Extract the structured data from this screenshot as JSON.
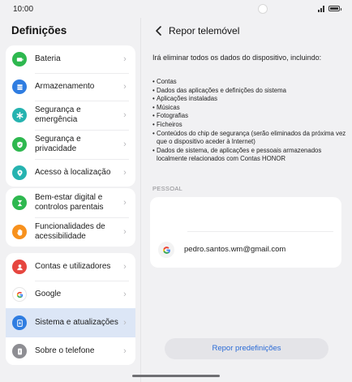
{
  "status_bar": {
    "time": "10:00"
  },
  "left": {
    "title": "Definições",
    "groups": [
      [
        {
          "label": "Bateria",
          "icon": "battery-icon",
          "color": "#2eb84f"
        },
        {
          "label": "Armazenamento",
          "icon": "storage-icon",
          "color": "#2f7de1"
        },
        {
          "label": "Segurança e emergência",
          "icon": "emergency-icon",
          "color": "#26b3b0"
        },
        {
          "label": "Segurança e privacidade",
          "icon": "shield-icon",
          "color": "#2eb84f"
        },
        {
          "label": "Acesso à localização",
          "icon": "location-icon",
          "color": "#26b3b0"
        }
      ],
      [
        {
          "label": "Bem-estar digital e controlos parentais",
          "icon": "hourglass-icon",
          "color": "#2eb84f"
        },
        {
          "label": "Funcionalidades de acessibilidade",
          "icon": "hand-icon",
          "color": "#f7911d"
        }
      ],
      [
        {
          "label": "Contas e utilizadores",
          "icon": "account-icon",
          "color": "#e6463f"
        },
        {
          "label": "Google",
          "icon": "google-icon",
          "color": "#ffffff"
        },
        {
          "label": "Sistema e atualizações",
          "icon": "system-update-icon",
          "color": "#2f7de1"
        },
        {
          "label": "Sobre o telefone",
          "icon": "phone-info-icon",
          "color": "#8e8e93"
        }
      ]
    ]
  },
  "right": {
    "title": "Repor telemóvel",
    "intro": "Irá eliminar todos os dados do dispositivo, incluindo:",
    "bullets": [
      "Contas",
      "Dados das aplicações e definições do sistema",
      "Aplicações instaladas",
      "Músicas",
      "Fotografias",
      "Ficheiros",
      "Conteúdos do chip de segurança (serão eliminados da próxima vez que o dispositivo aceder à Internet)",
      "Dados de sistema, de aplicações e pessoais armazenados localmente relacionados com Contas HONOR"
    ],
    "section_label": "PESSOAL",
    "account_email": "pedro.santos.wm@gmail.com",
    "reset_button": "Repor predefinições"
  },
  "colors": {
    "accent": "#2b6bd6",
    "selected_bg": "#dce6f6"
  }
}
